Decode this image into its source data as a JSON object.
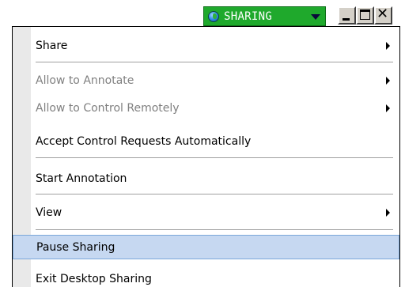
{
  "titlebar": {
    "status_label": "SHARING",
    "status_color": "#1fa92c",
    "globe_icon": "globe-icon",
    "dropdown_icon": "chevron-down-icon",
    "window_controls": [
      "minimize-icon",
      "maximize-icon",
      "close-icon"
    ]
  },
  "menu": {
    "items": [
      {
        "label": "Share",
        "enabled": true,
        "submenu": true
      },
      {
        "label": "Allow to Annotate",
        "enabled": false,
        "submenu": true
      },
      {
        "label": "Allow to Control Remotely",
        "enabled": false,
        "submenu": true
      },
      {
        "label": "Accept Control Requests Automatically",
        "enabled": true,
        "submenu": false
      },
      {
        "label": "Start Annotation",
        "enabled": true,
        "submenu": false
      },
      {
        "label": "View",
        "enabled": true,
        "submenu": true
      },
      {
        "label": "Pause Sharing",
        "enabled": true,
        "submenu": false,
        "highlighted": true
      },
      {
        "label": "Exit Desktop Sharing",
        "enabled": true,
        "submenu": false
      }
    ],
    "highlight_color": "#c6d8f1"
  }
}
